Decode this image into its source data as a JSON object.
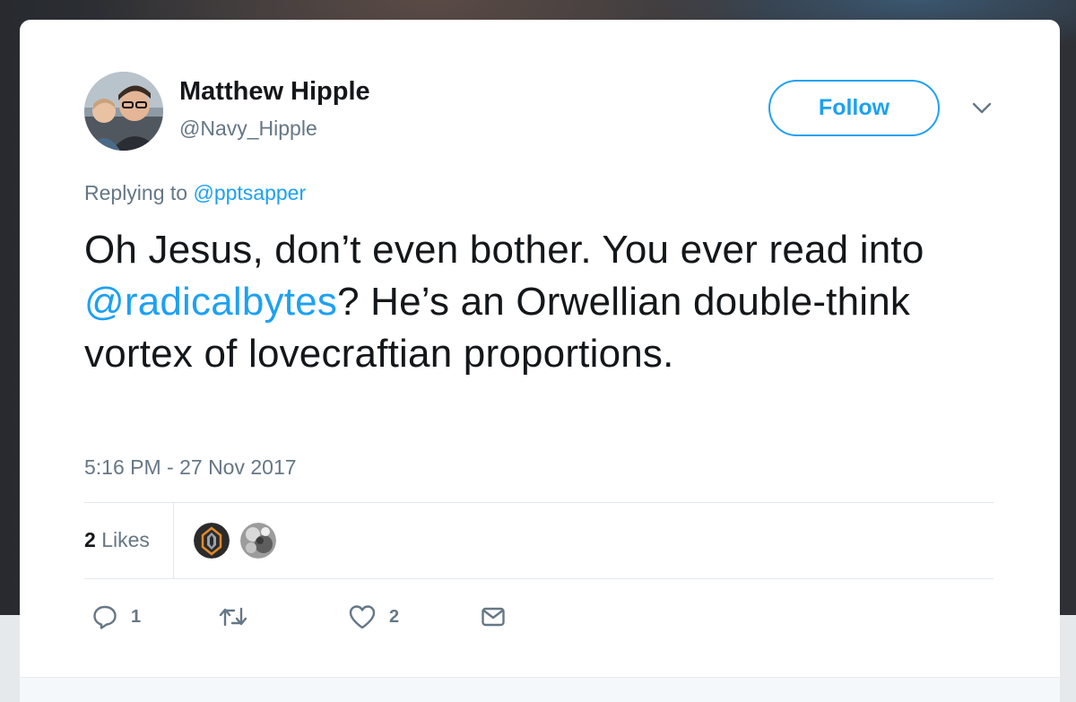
{
  "tweet": {
    "author_name": "Matthew Hipple",
    "author_handle": "@Navy_Hipple",
    "follow_label": "Follow",
    "replying_prefix": "Replying to",
    "replying_to": "@pptsapper",
    "text_part1": "Oh Jesus, don’t even bother. You ever read into ",
    "text_mention": "@radicalbytes",
    "text_part2": "? He’s an Orwellian double-think vortex of lovecraftian proportions.",
    "timestamp": "5:16 PM - 27 Nov 2017"
  },
  "stats": {
    "likes_count": "2",
    "likes_label": "Likes"
  },
  "actions": {
    "reply_count": "1",
    "retweet_count": "",
    "like_count": "2"
  },
  "icons": {
    "caret": "chevron-down-icon",
    "reply": "reply-icon",
    "retweet": "retweet-icon",
    "like": "heart-icon",
    "dm": "envelope-icon"
  },
  "colors": {
    "accent": "#1da1f2",
    "text_primary": "#14171a",
    "text_secondary": "#657786",
    "divider": "#e1e8ed"
  }
}
